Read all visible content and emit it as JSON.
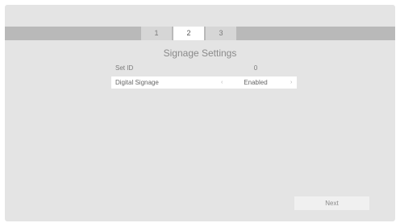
{
  "steps": [
    "1",
    "2",
    "3"
  ],
  "active_step": "2",
  "title": "Signage Settings",
  "rows": {
    "set_id": {
      "label": "Set ID",
      "value": "0"
    },
    "digital_signage": {
      "label": "Digital Signage",
      "value": "Enabled",
      "left_arrow": "‹",
      "right_arrow": "›"
    }
  },
  "next_label": "Next"
}
